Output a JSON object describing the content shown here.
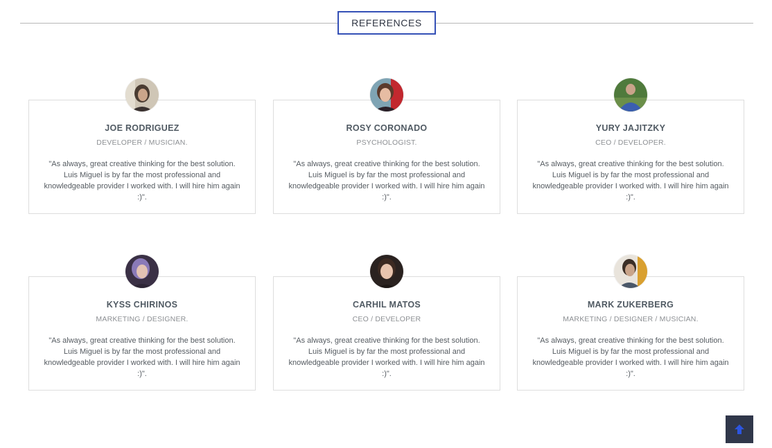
{
  "section": {
    "title": "REFERENCES"
  },
  "references": [
    {
      "name": "JOE RODRIGUEZ",
      "role": "DEVELOPER / MUSICIAN.",
      "quote": "\"As always, great creative thinking for the best solution. Luis Miguel is by far the most professional and knowledgeable provider I worked with. I will hire him again :)\"."
    },
    {
      "name": "ROSY CORONADO",
      "role": "PSYCHOLOGIST.",
      "quote": "\"As always, great creative thinking for the best solution. Luis Miguel is by far the most professional and knowledgeable provider I worked with. I will hire him again :)\"."
    },
    {
      "name": "YURY JAJITZKY",
      "role": "CEO / DEVELOPER.",
      "quote": "\"As always, great creative thinking for the best solution. Luis Miguel is by far the most professional and knowledgeable provider I worked with. I will hire him again :)\"."
    },
    {
      "name": "KYSS CHIRINOS",
      "role": "MARKETING / DESIGNER.",
      "quote": "\"As always, great creative thinking for the best solution. Luis Miguel is by far the most professional and knowledgeable provider I worked with. I will hire him again :)\"."
    },
    {
      "name": "CARHIL MATOS",
      "role": "CEO / DEVELOPER",
      "quote": "\"As always, great creative thinking for the best solution. Luis Miguel is by far the most professional and knowledgeable provider I worked with. I will hire him again :)\"."
    },
    {
      "name": "MARK ZUKERBERG",
      "role": "MARKETING / DESIGNER / MUSICIAN.",
      "quote": "\"As always, great creative thinking for the best solution. Luis Miguel is by far the most professional and knowledgeable provider I worked with. I will hire him again :)\"."
    }
  ],
  "scroll_top": {
    "icon": "arrow-up-icon"
  },
  "colors": {
    "header_border": "#3450b6",
    "scroll_top_bg": "#30374a",
    "scroll_top_icon": "#2c55e0",
    "card_border": "#dddddd"
  }
}
